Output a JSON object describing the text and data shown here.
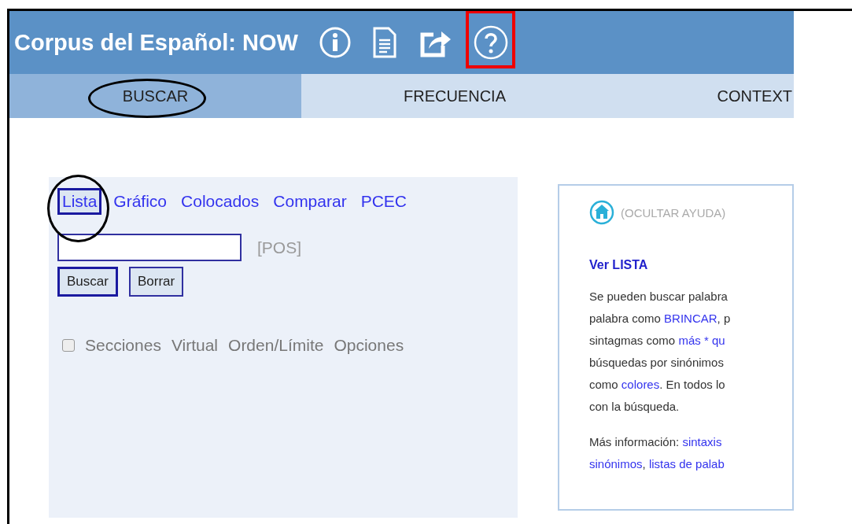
{
  "header": {
    "title": "Corpus del Español: NOW",
    "icons": [
      {
        "kind": "info",
        "boxed": false
      },
      {
        "kind": "document",
        "boxed": false
      },
      {
        "kind": "external",
        "boxed": false
      },
      {
        "kind": "help",
        "boxed": true
      }
    ]
  },
  "tabs": [
    {
      "label": "BUSCAR",
      "selected": true,
      "circled": true
    },
    {
      "label": "FRECUENCIA",
      "selected": false,
      "circled": false
    },
    {
      "label": "CONTEXT",
      "selected": false,
      "circled": false
    }
  ],
  "modes": [
    {
      "label": "Lista",
      "selected": true,
      "circled": true
    },
    {
      "label": "Gráfico",
      "selected": false,
      "circled": false
    },
    {
      "label": "Colocados",
      "selected": false,
      "circled": false
    },
    {
      "label": "Comparar",
      "selected": false,
      "circled": false
    },
    {
      "label": "PCEC",
      "selected": false,
      "circled": false
    }
  ],
  "search": {
    "pos_hint": "[POS]",
    "buttons": [
      {
        "label": "Buscar",
        "selected": true
      },
      {
        "label": "Borrar",
        "selected": false
      }
    ]
  },
  "options": {
    "checked": false,
    "items": [
      "Secciones",
      "Virtual",
      "Orden/Límite",
      "Opciones"
    ]
  },
  "help": {
    "hide_label": "(OCULTAR AYUDA)",
    "heading": "Ver LISTA",
    "paragraphs": [
      [
        [
          {
            "text": "Se pueden buscar palabra",
            "link": false
          }
        ],
        [
          {
            "text": "palabra como ",
            "link": false
          },
          {
            "text": "BRINCAR",
            "link": true
          },
          {
            "text": ", p",
            "link": false
          }
        ],
        [
          {
            "text": "sintagmas como ",
            "link": false
          },
          {
            "text": "más * qu",
            "link": true
          }
        ],
        [
          {
            "text": "búsquedas por sinónimos",
            "link": false
          }
        ],
        [
          {
            "text": "como ",
            "link": false
          },
          {
            "text": "colores",
            "link": true
          },
          {
            "text": ". En todos lo",
            "link": false
          }
        ],
        [
          {
            "text": "con la búsqueda.",
            "link": false
          }
        ]
      ],
      [
        [
          {
            "text": "Más información: ",
            "link": false
          },
          {
            "text": "sintaxis",
            "link": true
          }
        ],
        [
          {
            "text": "sinónimos",
            "link": true
          },
          {
            "text": ", ",
            "link": false
          },
          {
            "text": "listas de palab",
            "link": true
          }
        ]
      ]
    ]
  }
}
